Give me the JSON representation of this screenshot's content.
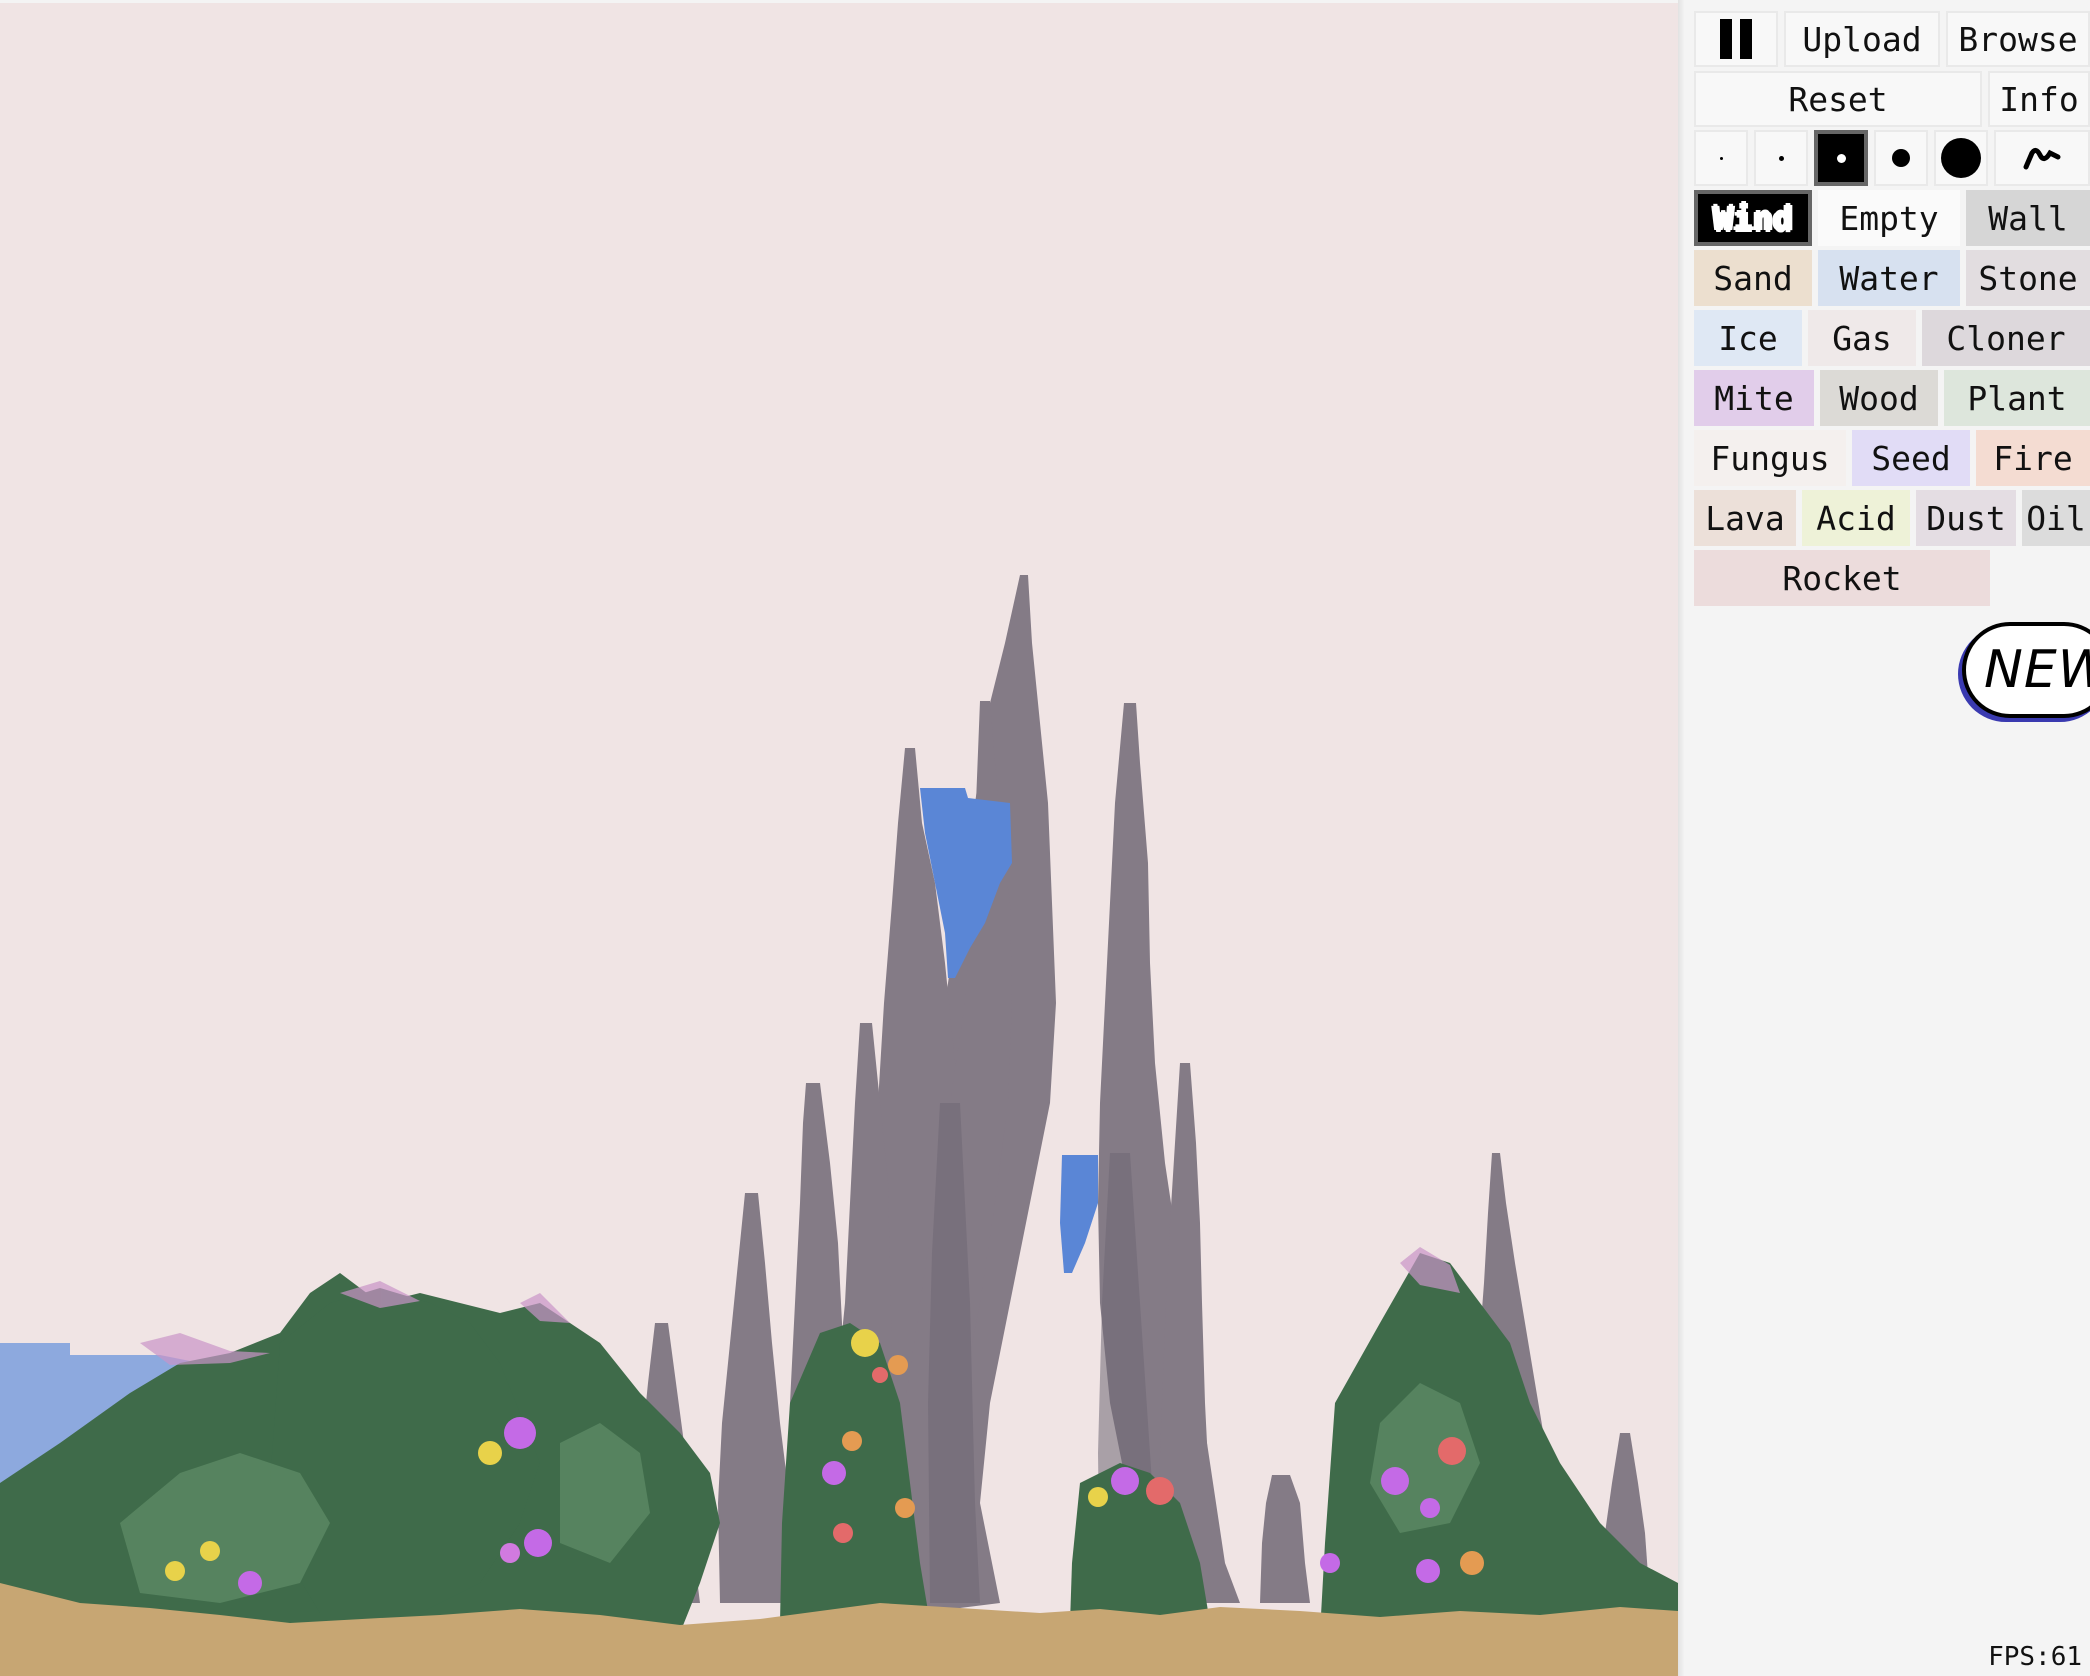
{
  "controls": {
    "pause_icon": "pause-icon",
    "upload_label": "Upload",
    "browse_label": "Browse",
    "reset_label": "Reset",
    "info_label": "Info"
  },
  "brush_sizes": [
    {
      "name": "brush-size-1",
      "level": 1,
      "selected": false
    },
    {
      "name": "brush-size-2",
      "level": 2,
      "selected": false
    },
    {
      "name": "brush-size-3",
      "level": 3,
      "selected": true
    },
    {
      "name": "brush-size-4",
      "level": 4,
      "selected": false
    },
    {
      "name": "brush-size-5",
      "level": 5,
      "selected": false
    },
    {
      "name": "brush-freeform",
      "icon": "squiggle-icon",
      "selected": false
    }
  ],
  "elements": [
    {
      "label": "Wind",
      "color": "#000000",
      "selected": true
    },
    {
      "label": "Empty",
      "color": "#fafafa"
    },
    {
      "label": "Wall",
      "color": "#d6d6d6"
    },
    {
      "label": "Sand",
      "color": "#ecdfcf"
    },
    {
      "label": "Water",
      "color": "#d7e1f0"
    },
    {
      "label": "Stone",
      "color": "#e2dde0"
    },
    {
      "label": "Ice",
      "color": "#dfe8f4"
    },
    {
      "label": "Gas",
      "color": "#efe9e9"
    },
    {
      "label": "Cloner",
      "color": "#ddd8dc"
    },
    {
      "label": "Mite",
      "color": "#e1cdea"
    },
    {
      "label": "Wood",
      "color": "#dcdad6"
    },
    {
      "label": "Plant",
      "color": "#dde6dc"
    },
    {
      "label": "Fungus",
      "color": "#f4f0ee"
    },
    {
      "label": "Seed",
      "color": "#e1dcf6"
    },
    {
      "label": "Fire",
      "color": "#f4dcd2"
    },
    {
      "label": "Lava",
      "color": "#ece0d9"
    },
    {
      "label": "Acid",
      "color": "#eef2d8"
    },
    {
      "label": "Dust",
      "color": "#e4dde3"
    },
    {
      "label": "Oil",
      "color": "#dcdcdc"
    },
    {
      "label": "Rocket",
      "color": "#ecdcdc"
    }
  ],
  "badge": {
    "label": "NEW"
  },
  "status": {
    "fps": "FPS:61"
  },
  "palette": {
    "sky": "#f0e4e4",
    "sand": "#c7a673",
    "stone": "#847b86",
    "stone_dark": "#6f6874",
    "water": "#8da9de",
    "water_bright": "#5a86d6",
    "plant": "#3f6b4a",
    "plant_light": "#5c8a64",
    "flower_colors": [
      "#e8d24a",
      "#c46ae6",
      "#e36a6a",
      "#e49b52",
      "#d17adf"
    ]
  }
}
